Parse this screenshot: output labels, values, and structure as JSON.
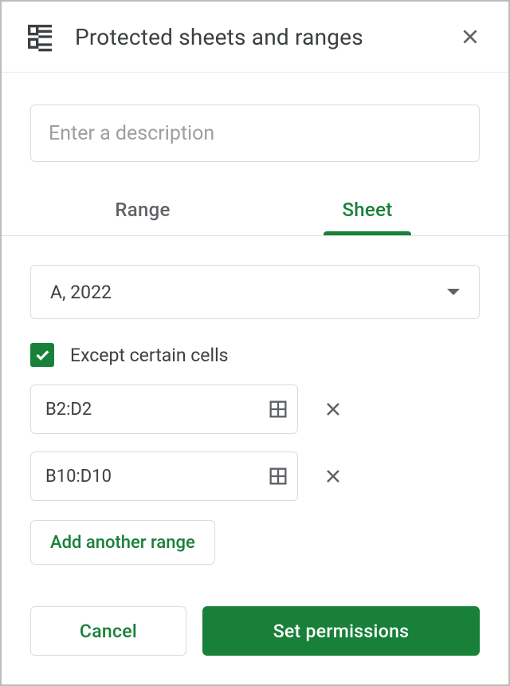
{
  "header": {
    "title": "Protected sheets and ranges"
  },
  "description": {
    "value": "",
    "placeholder": "Enter a description"
  },
  "tabs": {
    "range": "Range",
    "sheet": "Sheet",
    "active": "sheet"
  },
  "sheet_select": {
    "selected": "A, 2022"
  },
  "except_cells": {
    "checked": true,
    "label": "Except certain cells"
  },
  "ranges": [
    {
      "value": "B2:D2"
    },
    {
      "value": "B10:D10"
    }
  ],
  "buttons": {
    "add_range": "Add another range",
    "cancel": "Cancel",
    "set_permissions": "Set permissions"
  }
}
